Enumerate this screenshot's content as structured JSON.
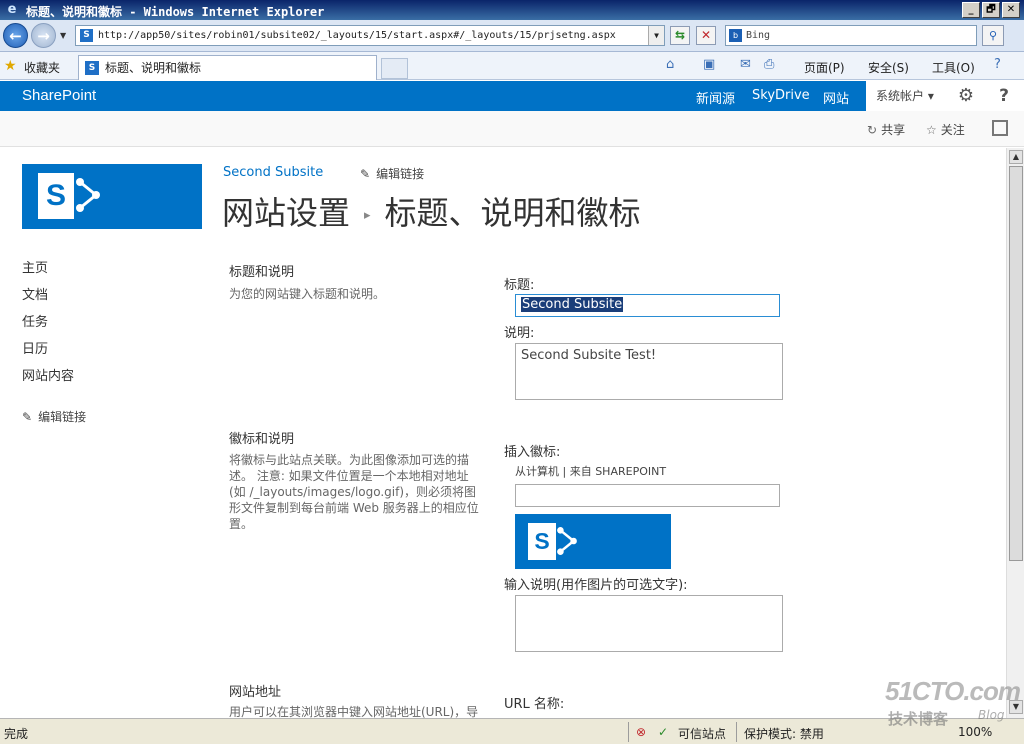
{
  "window": {
    "title": "标题、说明和徽标 - Windows Internet Explorer",
    "controls": [
      "_",
      "🗗",
      "✕"
    ]
  },
  "address": {
    "url": "http://app50/sites/robin01/subsite02/_layouts/15/start.aspx#/_layouts/15/prjsetng.aspx",
    "search_placeholder": "Bing"
  },
  "favorites": {
    "label": "收藏夹",
    "tab_title": "标题、说明和徽标"
  },
  "commandbar": {
    "page": "页面(P)",
    "safety": "安全(S)",
    "tools": "工具(O)"
  },
  "suitebar": {
    "brand": "SharePoint",
    "links": [
      "新闻源",
      "SkyDrive",
      "网站"
    ],
    "user": "系统帐户",
    "accent_color": "#0072c6"
  },
  "ribbon": {
    "share": "共享",
    "follow": "关注"
  },
  "header": {
    "site_name": "Second Subsite",
    "edit_links": "编辑链接",
    "breadcrumb_root": "网站设置",
    "page_title": "标题、说明和徽标"
  },
  "leftnav": {
    "items": [
      "主页",
      "文档",
      "任务",
      "日历",
      "网站内容"
    ],
    "edit_links": "编辑链接"
  },
  "sections": {
    "title_desc": {
      "heading": "标题和说明",
      "description": "为您的网站键入标题和说明。"
    },
    "logo": {
      "heading": "徽标和说明",
      "description": "将徽标与此站点关联。为此图像添加可选的描述。 注意: 如果文件位置是一个本地相对地址(如 /_layouts/images/logo.gif)，则必须将图形文件复制到每台前端 Web 服务器上的相应位置。"
    },
    "url": {
      "heading": "网站地址",
      "description": "用户可以在其浏览器中键入网站地址(URL)，导"
    }
  },
  "form": {
    "title_label": "标题:",
    "title_value": "Second Subsite",
    "description_label": "说明:",
    "description_value": "Second Subsite Test!",
    "insert_logo_label": "插入徽标:",
    "logo_sources": "从计算机 | 来自 SHAREPOINT",
    "logo_url_value": "",
    "alt_text_label": "输入说明(用作图片的可选文字):",
    "alt_text_value": "",
    "url_name_label": "URL 名称:"
  },
  "statusbar": {
    "status": "完成",
    "zone": "可信站点",
    "protected_mode": "保护模式: 禁用",
    "zoom": "100%"
  },
  "watermark": {
    "site": "51CTO.com",
    "line2": "技术博客",
    "line3": "Blog"
  }
}
